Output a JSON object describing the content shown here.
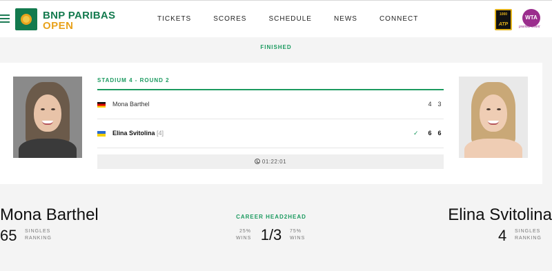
{
  "header": {
    "brand_line1": "BNP PARIBAS",
    "brand_line2": "OPEN",
    "nav": [
      "TICKETS",
      "SCORES",
      "SCHEDULE",
      "NEWS",
      "CONNECT"
    ],
    "atp_number": "1000",
    "atp_label": "ATP",
    "wta_label": "WTA",
    "wta_sub": "premier event"
  },
  "match": {
    "status": "FINISHED",
    "round": "STADIUM 4 - ROUND 2",
    "players": [
      {
        "name": "Mona Barthel",
        "seed": "",
        "sets": [
          "4",
          "3"
        ],
        "winner": false
      },
      {
        "name": "Elina Svitolina",
        "seed": "[4]",
        "sets": [
          "6",
          "6"
        ],
        "winner": true,
        "check": "✓"
      }
    ],
    "duration": "01:22:01"
  },
  "summary": {
    "left": {
      "name": "Mona Barthel",
      "ranking": "65",
      "label_line1": "SINGLES",
      "label_line2": "RANKING",
      "win_pct": "25%",
      "wins_label": "WINS"
    },
    "right": {
      "name": "Elina Svitolina",
      "ranking": "4",
      "label_line1": "SINGLES",
      "label_line2": "RANKING",
      "win_pct": "75%",
      "wins_label": "WINS"
    },
    "h2h_title": "CAREER HEAD2HEAD",
    "h2h_score": "1/3"
  },
  "colors": {
    "brand_green": "#137a4e",
    "accent_green": "#1b9a5f",
    "brand_gold": "#e8a21c",
    "wta_purple": "#9b2d8d"
  },
  "icons": [
    "menu-icon",
    "tournament-logo",
    "atp-1000-logo",
    "wta-logo",
    "flag-germany",
    "flag-ukraine",
    "check-icon",
    "clock-icon"
  ]
}
